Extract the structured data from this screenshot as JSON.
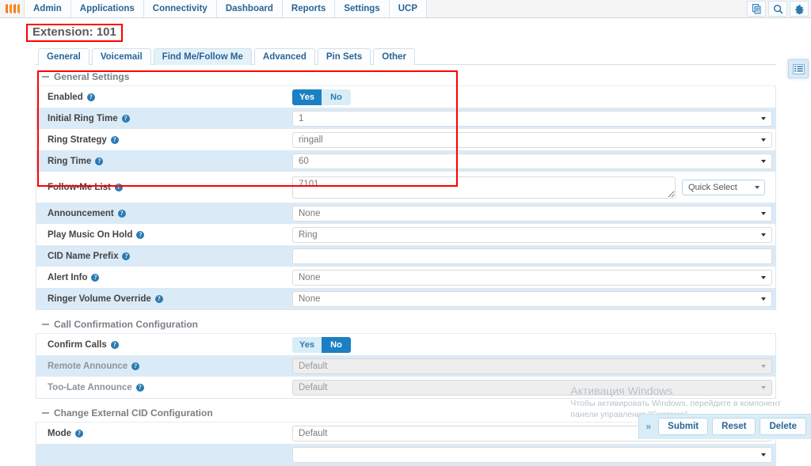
{
  "nav": {
    "logo_name": "freepbx-logo",
    "items": [
      {
        "label": "Admin"
      },
      {
        "label": "Applications"
      },
      {
        "label": "Connectivity"
      },
      {
        "label": "Dashboard"
      },
      {
        "label": "Reports"
      },
      {
        "label": "Settings"
      },
      {
        "label": "UCP"
      }
    ],
    "right_icons": [
      {
        "name": "module-admin-icon"
      },
      {
        "name": "search-icon"
      },
      {
        "name": "gear-icon"
      }
    ]
  },
  "header": {
    "title": "Extension: 101"
  },
  "tabs": [
    {
      "label": "General",
      "active": false
    },
    {
      "label": "Voicemail",
      "active": false
    },
    {
      "label": "Find Me/Follow Me",
      "active": true
    },
    {
      "label": "Advanced",
      "active": false
    },
    {
      "label": "Pin Sets",
      "active": false
    },
    {
      "label": "Other",
      "active": false
    }
  ],
  "sections": [
    {
      "title": "General Settings",
      "rows": [
        {
          "label": "Enabled",
          "type": "toggle",
          "options": [
            "Yes",
            "No"
          ],
          "value": "Yes"
        },
        {
          "label": "Initial Ring Time",
          "type": "select",
          "value": "1"
        },
        {
          "label": "Ring Strategy",
          "type": "select",
          "value": "ringall"
        },
        {
          "label": "Ring Time",
          "type": "select",
          "value": "60"
        },
        {
          "label": "Follow-Me List",
          "type": "textarea",
          "value": "7101",
          "quick_select": "Quick Select"
        },
        {
          "label": "Announcement",
          "type": "select",
          "value": "None"
        },
        {
          "label": "Play Music On Hold",
          "type": "select",
          "value": "Ring"
        },
        {
          "label": "CID Name Prefix",
          "type": "text",
          "value": ""
        },
        {
          "label": "Alert Info",
          "type": "select",
          "value": "None"
        },
        {
          "label": "Ringer Volume Override",
          "type": "select",
          "value": "None"
        }
      ]
    },
    {
      "title": "Call Confirmation Configuration",
      "rows": [
        {
          "label": "Confirm Calls",
          "type": "toggle",
          "options": [
            "Yes",
            "No"
          ],
          "value": "No"
        },
        {
          "label": "Remote Announce",
          "type": "select",
          "value": "Default",
          "disabled": true
        },
        {
          "label": "Too-Late Announce",
          "type": "select",
          "value": "Default",
          "disabled": true
        }
      ]
    },
    {
      "title": "Change External CID Configuration",
      "rows": [
        {
          "label": "Mode",
          "type": "select",
          "value": "Default"
        }
      ]
    }
  ],
  "side_toggle": {
    "name": "list-toggle-icon"
  },
  "actions": {
    "expand_chevron": "»",
    "submit_label": "Submit",
    "reset_label": "Reset",
    "delete_label": "Delete"
  },
  "watermark": {
    "title": "Активация Windows",
    "line1": "Чтобы активировать Windows, перейдите в компонент",
    "line2": "панели управления \"Система\"."
  },
  "annotations": {
    "highlight_color": "#ff0000",
    "boxes": [
      {
        "name": "page-title-highlight"
      },
      {
        "name": "general-settings-highlight"
      }
    ]
  }
}
